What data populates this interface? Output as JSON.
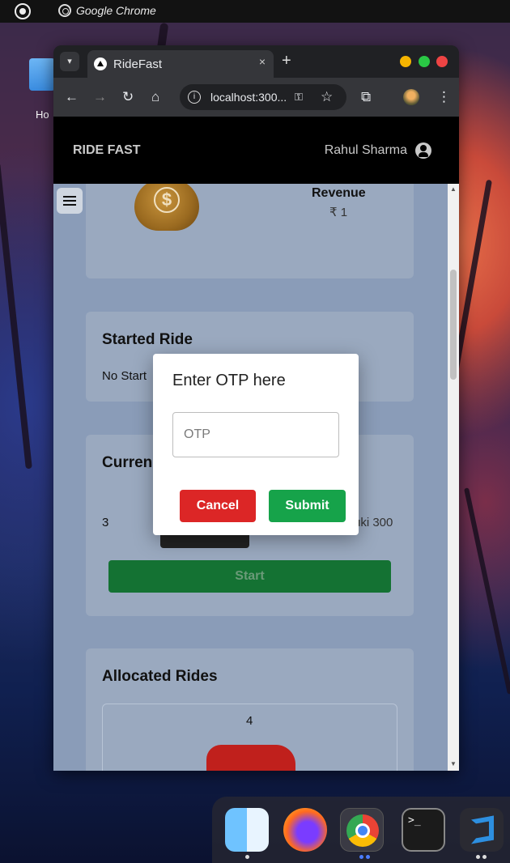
{
  "topbar": {
    "app_name": "Google Chrome"
  },
  "desktop": {
    "folder_label": "Ho"
  },
  "browser": {
    "tab_title": "RideFast",
    "tab_close": "×",
    "new_tab": "+",
    "url": "localhost:300...",
    "window_controls": {
      "minimize_color": "#f5b400",
      "maximize_color": "#2ac845",
      "close_color": "#ee4444"
    }
  },
  "navbar": {
    "brand": "RIDE FAST",
    "user_name": "Rahul Sharma"
  },
  "revenue_card": {
    "label": "Revenue",
    "value": "₹ 1"
  },
  "started_ride_card": {
    "title": "Started Ride",
    "text": "No Start"
  },
  "current_ride_card": {
    "title": "Curren",
    "ride_id": "3",
    "car_text": "uki 300",
    "button": "Start"
  },
  "allocated_card": {
    "title": "Allocated Rides",
    "ride_id": "4"
  },
  "modal": {
    "title": "Enter OTP here",
    "otp_placeholder": "OTP",
    "cancel_label": "Cancel",
    "submit_label": "Submit"
  },
  "dock": {
    "apps": [
      "finder-icon",
      "firefox-icon",
      "chrome-icon",
      "terminal-icon",
      "vscode-icon"
    ]
  },
  "colors": {
    "cancel": "#dc2626",
    "submit": "#16a34a",
    "start_button": "#147233"
  }
}
